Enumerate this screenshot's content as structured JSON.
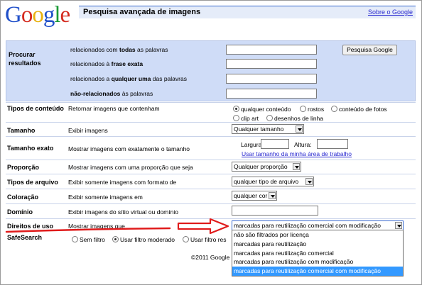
{
  "header": {
    "logo_letters": [
      "G",
      "o",
      "o",
      "g",
      "l",
      "e"
    ],
    "title": "Pesquisa avançada de imagens",
    "about_link": "Sobre o Google"
  },
  "find": {
    "label": "Procurar resultados",
    "rows": [
      {
        "pre": "relacionados com ",
        "bold": "todas",
        "post": " as palavras",
        "value": ""
      },
      {
        "pre": "relacionados à ",
        "bold": "frase exata",
        "post": "",
        "value": ""
      },
      {
        "pre": "relacionados a ",
        "bold": "qualquer uma",
        "post": " das palavras",
        "value": ""
      },
      {
        "pre": "",
        "bold": "não-relacionados",
        "post": " às palavras",
        "value": ""
      }
    ],
    "search_button": "Pesquisa Google"
  },
  "content_type": {
    "label": "Tipos de conteúdo",
    "desc": "Retornar imagens que contenham",
    "options": [
      "qualquer conteúdo",
      "rostos",
      "conteúdo de fotos",
      "clip art",
      "desenhos de linha"
    ],
    "selected": "qualquer conteúdo"
  },
  "size": {
    "label": "Tamanho",
    "desc": "Exibir imagens",
    "value": "Qualquer tamanho"
  },
  "exact_size": {
    "label": "Tamanho exato",
    "desc": "Mostrar imagens com exatamente o tamanho",
    "width_label": "Largura:",
    "height_label": "Altura:",
    "width_value": "",
    "height_value": "",
    "link": "Usar tamanho da minha área de trabalho"
  },
  "aspect": {
    "label": "Proporção",
    "desc": "Mostrar imagens com uma proporção que seja",
    "value": "Qualquer proporção"
  },
  "file_type": {
    "label": "Tipos de arquivo",
    "desc": "Exibir somente imagens com formato de",
    "value": "qualquer tipo de arquivo"
  },
  "color": {
    "label": "Coloração",
    "desc": "Exibir somente imagens em",
    "value": "qualquer cor"
  },
  "domain": {
    "label": "Domínio",
    "desc": "Exibir imagens do sítio virtual ou domínio",
    "value": ""
  },
  "usage_rights": {
    "label": "Direitos de uso",
    "desc": "Mostrar imagens que",
    "value": "marcadas para reutilização comercial com modificação",
    "options": [
      "não são filtrados por licença",
      "marcadas para reutilização",
      "marcadas para reutilização comercial",
      "marcadas para reutilização com modificação",
      "marcadas para reutilização comercial com modificação"
    ],
    "highlighted_index": 4
  },
  "safesearch": {
    "label": "SafeSearch",
    "options": [
      "Sem filtro",
      "Usar filtro moderado",
      "Usar filtro restrito"
    ],
    "visible_options": [
      "Sem filtro",
      "Usar filtro moderado",
      "Usar filtro res"
    ],
    "selected": "Usar filtro moderado"
  },
  "footer": {
    "copyright": "©2011 Google"
  },
  "colors": {
    "header_bg": "#e5ecf9",
    "find_bg": "#cfdcf7",
    "arrow": "#e01b1b",
    "link": "#2a2ad0",
    "highlight": "#3399ff"
  }
}
